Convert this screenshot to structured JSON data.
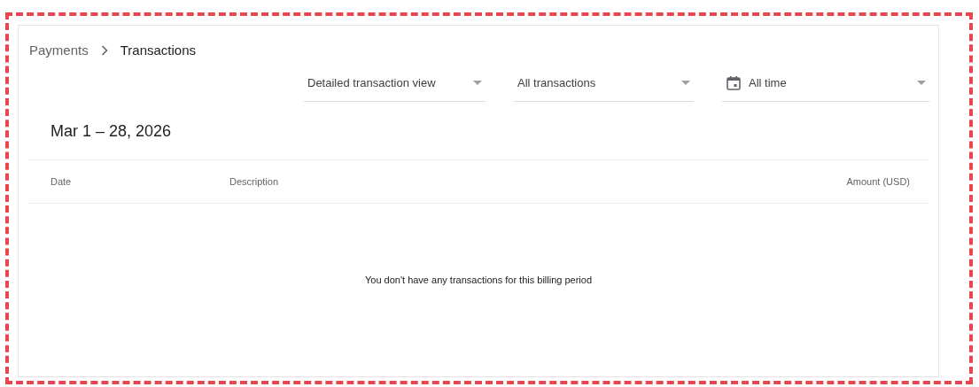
{
  "breadcrumb": [
    {
      "label": "Payments",
      "current": false
    },
    {
      "label": "Transactions",
      "current": true
    }
  ],
  "filters": [
    {
      "kind": "select",
      "value": "Detailed transaction view"
    },
    {
      "kind": "select",
      "value": "All transactions"
    },
    {
      "kind": "date",
      "value": "All time"
    }
  ],
  "period": "Mar 1 – 28, 2026",
  "table": {
    "columns": [
      "Date",
      "Description",
      "Amount (USD)"
    ],
    "empty_message": "You don't have any transactions for this billing period"
  }
}
